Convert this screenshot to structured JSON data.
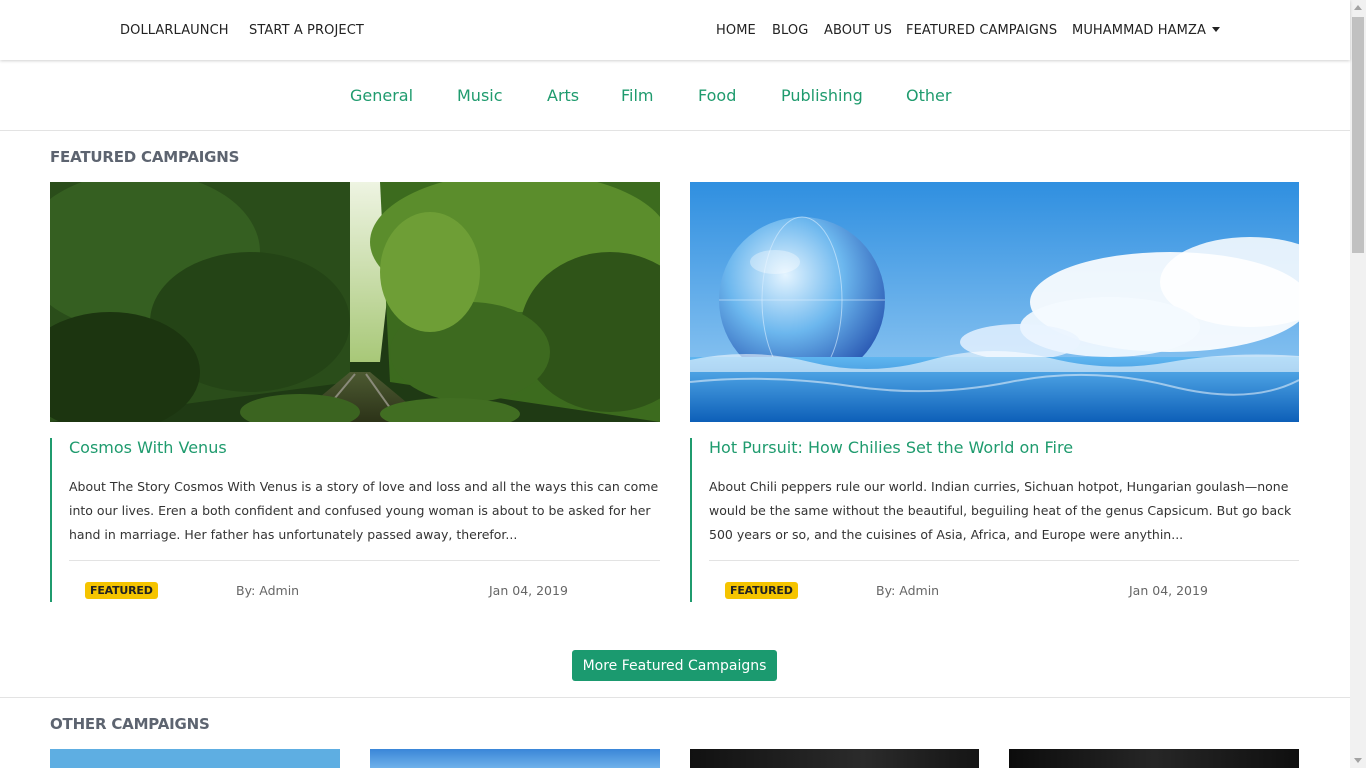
{
  "nav": {
    "brand": "DOLLARLAUNCH",
    "start_project": "START A PROJECT",
    "home": "HOME",
    "blog": "BLOG",
    "about": "ABOUT US",
    "featured": "FEATURED CAMPAIGNS",
    "user": "MUHAMMAD HAMZA"
  },
  "categories": [
    "General",
    "Music",
    "Arts",
    "Film",
    "Food",
    "Publishing",
    "Other"
  ],
  "featured_title": "FEATURED CAMPAIGNS",
  "cards": [
    {
      "title": "Cosmos With Venus",
      "description": "About The Story Cosmos With Venus is a story of love and loss and all the ways this can come into our lives. Eren a both confident and confused young woman is about to be asked for her hand in marriage. Her father has unfortunately passed away, therefor...",
      "badge": "FEATURED",
      "author": "By: Admin",
      "date": "Jan 04, 2019"
    },
    {
      "title": "Hot Pursuit: How Chilies Set the World on Fire",
      "description": "About Chili peppers rule our world. Indian curries, Sichuan hotpot, Hungarian goulash—none would be the same without the beautiful, beguiling heat of the genus Capsicum. But go back 500 years or so, and the cuisines of Asia, Africa, and Europe were anythin...",
      "badge": "FEATURED",
      "author": "By: Admin",
      "date": "Jan 04, 2019"
    }
  ],
  "more_button": "More Featured Campaigns",
  "other_title": "OTHER CAMPAIGNS",
  "colors": {
    "accent": "#1f9b6e",
    "badge": "#f5c400",
    "section_title": "#5d6470"
  }
}
